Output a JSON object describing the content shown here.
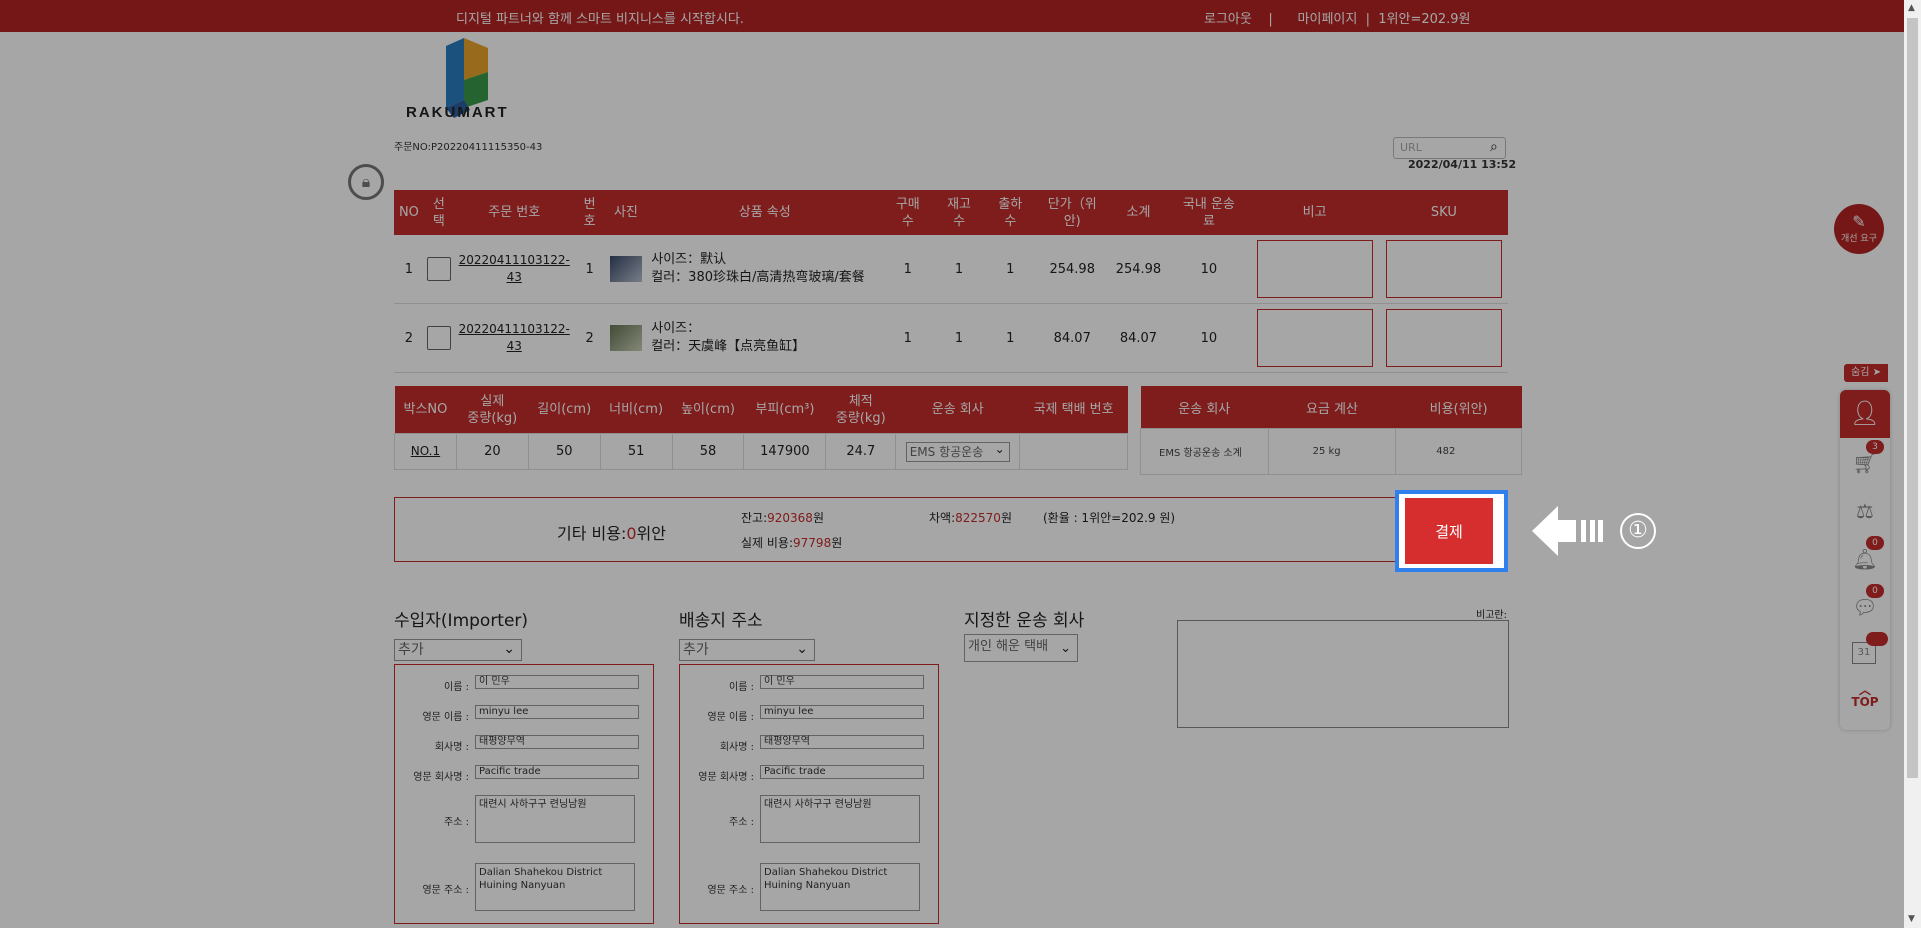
{
  "topbar": {
    "slogan": "디지털 파트너와 함께 스마트 비지니스를 시작합시다.",
    "links": "로그아웃    |      마이페이지  |  1위안=202.9원"
  },
  "logo": {
    "text": "RAKUMART"
  },
  "order": {
    "number": "주문NO:P20220411115350-43",
    "date": "2022/04/11 13:52"
  },
  "search": {
    "placeholder": "URL"
  },
  "products": {
    "headers": [
      "NO",
      "선\n택",
      "주문 번호",
      "번\n호",
      "사진",
      "상품 속성",
      "구매\n수",
      "재고\n수",
      "출하\n수",
      "단가（위\n안)",
      "소계",
      "국내 운송\n료",
      "비고",
      "SKU"
    ],
    "rows": [
      {
        "no": "1",
        "order_no": "20220411103122-43",
        "num": "1",
        "attr1": "사이즈：默认",
        "attr2": "컬러：380珍珠白/高清热弯玻璃/套餐",
        "buy": "1",
        "stock": "1",
        "ship": "1",
        "price": "254.98",
        "subtotal": "254.98",
        "domestic": "10"
      },
      {
        "no": "2",
        "order_no": "20220411103122-43",
        "num": "2",
        "attr1": "사이즈：",
        "attr2": "컬러：天虞峰【点亮鱼缸】",
        "buy": "1",
        "stock": "1",
        "ship": "1",
        "price": "84.07",
        "subtotal": "84.07",
        "domestic": "10"
      }
    ]
  },
  "boxes": {
    "headers": [
      "박스NO",
      "실제\n중량(kg)",
      "길이(cm)",
      "너비(cm)",
      "높이(cm)",
      "부피(cm³)",
      "체적\n중량(kg)",
      "운송 회사",
      "국제 택배 번호"
    ],
    "rows": [
      {
        "box_no": "NO.1",
        "weight": "20",
        "length": "50",
        "width": "51",
        "height": "58",
        "volume": "147900",
        "vol_weight": "24.7",
        "carrier": "EMS 항공운송",
        "tracking": ""
      }
    ]
  },
  "cost": {
    "headers": [
      "운송 회사",
      "요금 계산",
      "비용(위안)"
    ],
    "rows": [
      {
        "carrier": "EMS 항공운송  소계",
        "calc": "25  kg",
        "fee": "482"
      }
    ]
  },
  "fees": {
    "other_label": "기타 비용:",
    "other_value": "0",
    "other_unit": "위안",
    "balance_label": "잔고:",
    "balance_value": "920368",
    "won": "원",
    "diff_label": "차액:",
    "diff_value": "822570",
    "rate": "(환율 : 1위안=202.9 원)",
    "actual_label": "실제 비용:",
    "actual_value": "97798",
    "pay_button": "결제"
  },
  "step_marker": "①",
  "importer": {
    "title": "수입자(Importer)",
    "select": "추가",
    "fields": {
      "name_label": "이름 :",
      "name": "이 민우",
      "en_name_label": "영문 이름 :",
      "en_name": "minyu lee",
      "company_label": "회사명 :",
      "company": "태평양무역",
      "en_company_label": "영문 회사명 :",
      "en_company": "Pacific trade",
      "address_label": "주소 :",
      "address": "대련시 사하구구 련닝남원",
      "en_address_label": "영문 주소 :",
      "en_address": "Dalian Shahekou District Huining Nanyuan"
    }
  },
  "delivery": {
    "title": "배송지 주소",
    "select": "추가",
    "fields": {
      "name_label": "이름 :",
      "name": "이 민우",
      "en_name_label": "영문 이름 :",
      "en_name": "minyu lee",
      "company_label": "회사명 :",
      "company": "태평양무역",
      "en_company_label": "영문 회사명 :",
      "en_company": "Pacific trade",
      "address_label": "주소 :",
      "address": "대련시 사하구구 련닝남원",
      "en_address_label": "영문 주소 :",
      "en_address": "Dalian Shahekou District Huining Nanyuan"
    }
  },
  "shipping_company": {
    "title": "지정한 운송 회사",
    "select": "개인 해운 택배"
  },
  "remark": {
    "label": "비고란:"
  },
  "sidebar": {
    "feedback": "개선 요구",
    "hide_tab": "숨김 ➤",
    "cart_count": "3",
    "notice_count": "0",
    "message_count": "0",
    "calendar_day": "31",
    "top": "TOP"
  },
  "colors": {
    "brand": "#b52424",
    "accent": "#2f80ed"
  }
}
